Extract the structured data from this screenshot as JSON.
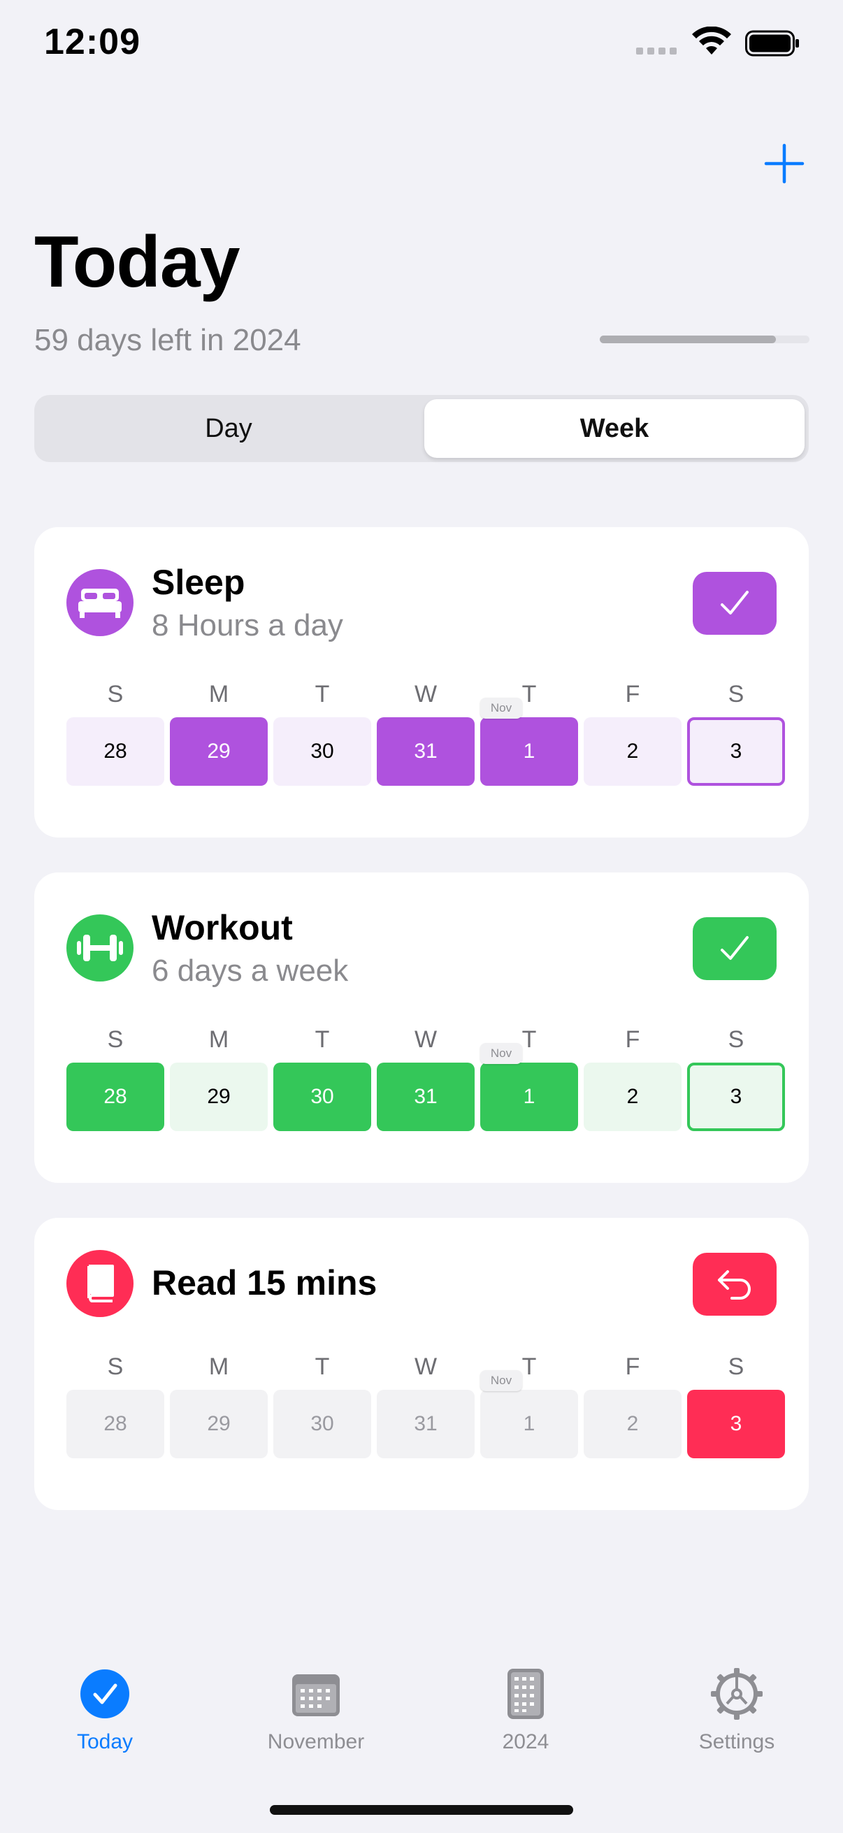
{
  "status_bar": {
    "time": "12:09"
  },
  "header": {
    "title": "Today",
    "subtitle": "59 days left in 2024",
    "year_progress": 0.84
  },
  "segmented": {
    "options": [
      "Day",
      "Week"
    ],
    "selected": "Week"
  },
  "habits": [
    {
      "name": "Sleep",
      "goal": "8 Hours a day",
      "icon": "bed-icon",
      "color": "#af52de",
      "tint": "#f5eefb",
      "action": "check",
      "weekdays": [
        "S",
        "M",
        "T",
        "W",
        "T",
        "F",
        "S"
      ],
      "days": [
        "28",
        "29",
        "30",
        "31",
        "1",
        "2",
        "3"
      ],
      "done": [
        false,
        true,
        false,
        true,
        true,
        false,
        false
      ],
      "month_marker": "Nov"
    },
    {
      "name": "Workout",
      "goal": "6 days a week",
      "icon": "dumbbell-icon",
      "color": "#34c759",
      "tint": "#ebf8ee",
      "action": "check",
      "weekdays": [
        "S",
        "M",
        "T",
        "W",
        "T",
        "F",
        "S"
      ],
      "days": [
        "28",
        "29",
        "30",
        "31",
        "1",
        "2",
        "3"
      ],
      "done": [
        true,
        false,
        true,
        true,
        true,
        false,
        false
      ],
      "month_marker": "Nov"
    },
    {
      "name": "Read 15 mins",
      "goal": "",
      "icon": "book-icon",
      "color": "#ff2d55",
      "tint": "#f2f2f4",
      "action": "undo",
      "weekdays": [
        "S",
        "M",
        "T",
        "W",
        "T",
        "F",
        "S"
      ],
      "days": [
        "28",
        "29",
        "30",
        "31",
        "1",
        "2",
        "3"
      ],
      "done": [
        false,
        false,
        false,
        false,
        false,
        false,
        true
      ],
      "month_marker": "Nov"
    }
  ],
  "tab_bar": {
    "items": [
      {
        "label": "Today",
        "icon": "checkmark-circle-icon",
        "active": true
      },
      {
        "label": "November",
        "icon": "calendar-month-icon",
        "active": false
      },
      {
        "label": "2024",
        "icon": "calendar-year-icon",
        "active": false
      },
      {
        "label": "Settings",
        "icon": "gear-icon",
        "active": false
      }
    ]
  },
  "colors": {
    "accent": "#0a7cff"
  }
}
